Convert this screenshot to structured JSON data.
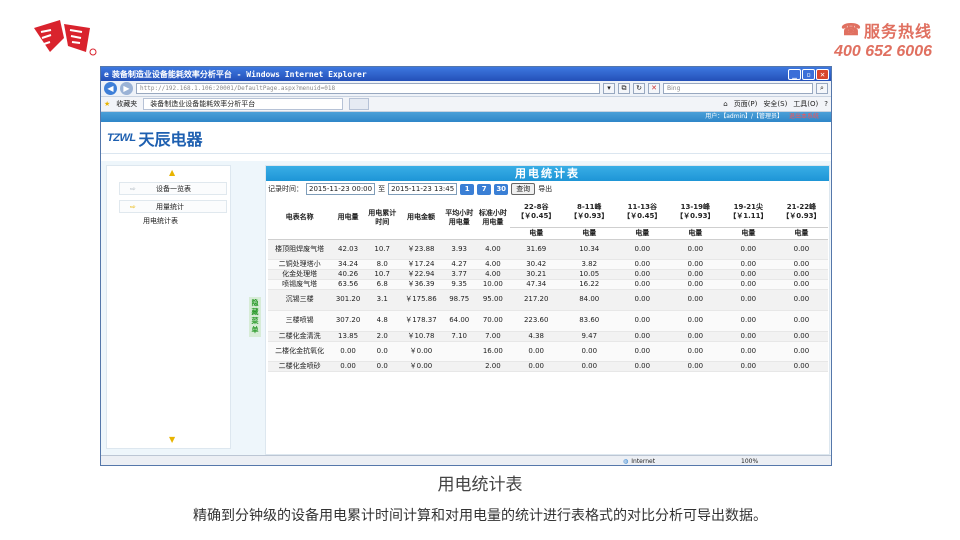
{
  "slide": {
    "hotline_label": "服务热线",
    "hotline_number": "400 652 6006",
    "caption": "用电统计表",
    "description": "精确到分钟级的设备用电累计时间计算和对用电量的统计进行表格式的对比分析可导出数据。"
  },
  "ie": {
    "title": "装备制造业设备能耗效率分析平台 - Windows Internet Explorer",
    "address": "http://192.168.1.106:20001/DefaultPage.aspx?menuid=018",
    "search_placeholder": "Bing",
    "favorites": "收藏夹",
    "tab_label": "装备制造业设备能耗效率分析平台",
    "page_menu": "页面(P)",
    "safety_menu": "安全(S)",
    "tools_menu": "工具(O)",
    "status_zone": "Internet",
    "zoom": "100%"
  },
  "app": {
    "user_text": "用户：【admin】/【管理员】",
    "exit_text": "退出本系统",
    "brand_mark": "TZWL",
    "brand_name": "天辰电器",
    "sidebar": {
      "items": [
        {
          "label": "设备一览表"
        },
        {
          "label": "用量统计"
        }
      ],
      "sub_item": "用电统计表",
      "hide_menu": "隐藏菜单"
    },
    "panel_title": "用电统计表",
    "toolbar": {
      "time_label": "记录时间：",
      "start": "2015-11-23 00:00",
      "to": "至",
      "end": "2015-11-23 13:45",
      "btn1": "1",
      "btn7": "7",
      "btn30": "30",
      "query": "查询",
      "export": "导出"
    }
  },
  "table": {
    "headers": {
      "name": "电表名称",
      "usage": "用电量",
      "time": "用电累计时间",
      "amount": "用电金额",
      "avg": "平均小时用电量",
      "std": "标准小时用电量",
      "p1": "22-8谷【￥0.45】",
      "p2": "8-11峰【￥0.93】",
      "p3": "11-13谷【￥0.45】",
      "p4": "13-19峰【￥0.93】",
      "p5": "19-21尖【￥1.11】",
      "p6": "21-22峰【￥0.93】",
      "sub": "电量"
    },
    "rows": [
      {
        "name": "楼顶阻焊废气塔",
        "usage": "42.03",
        "time": "10.7",
        "amount": "￥23.88",
        "avg": "3.93",
        "std": "4.00",
        "p1": "31.69",
        "p2": "10.34",
        "p3": "0.00",
        "p4": "0.00",
        "p5": "0.00",
        "p6": "0.00"
      },
      {
        "name": "二铜处理塔小",
        "usage": "34.24",
        "time": "8.0",
        "amount": "￥17.24",
        "avg": "4.27",
        "std": "4.00",
        "p1": "30.42",
        "p2": "3.82",
        "p3": "0.00",
        "p4": "0.00",
        "p5": "0.00",
        "p6": "0.00"
      },
      {
        "name": "化金处理塔",
        "usage": "40.26",
        "time": "10.7",
        "amount": "￥22.94",
        "avg": "3.77",
        "std": "4.00",
        "p1": "30.21",
        "p2": "10.05",
        "p3": "0.00",
        "p4": "0.00",
        "p5": "0.00",
        "p6": "0.00"
      },
      {
        "name": "喷锡废气塔",
        "usage": "63.56",
        "time": "6.8",
        "amount": "￥36.39",
        "avg": "9.35",
        "std": "10.00",
        "p1": "47.34",
        "p2": "16.22",
        "p3": "0.00",
        "p4": "0.00",
        "p5": "0.00",
        "p6": "0.00"
      },
      {
        "name": "沉锡三楼",
        "usage": "301.20",
        "time": "3.1",
        "amount": "￥175.86",
        "avg": "98.75",
        "std": "95.00",
        "p1": "217.20",
        "p2": "84.00",
        "p3": "0.00",
        "p4": "0.00",
        "p5": "0.00",
        "p6": "0.00"
      },
      {
        "name": "三楼喷锡",
        "usage": "307.20",
        "time": "4.8",
        "amount": "￥178.37",
        "avg": "64.00",
        "std": "70.00",
        "p1": "223.60",
        "p2": "83.60",
        "p3": "0.00",
        "p4": "0.00",
        "p5": "0.00",
        "p6": "0.00"
      },
      {
        "name": "二楼化金清洗",
        "usage": "13.85",
        "time": "2.0",
        "amount": "￥10.78",
        "avg": "7.10",
        "std": "7.00",
        "p1": "4.38",
        "p2": "9.47",
        "p3": "0.00",
        "p4": "0.00",
        "p5": "0.00",
        "p6": "0.00"
      },
      {
        "name": "二楼化金抗氧化",
        "usage": "0.00",
        "time": "0.0",
        "amount": "￥0.00",
        "avg": "",
        "std": "16.00",
        "p1": "0.00",
        "p2": "0.00",
        "p3": "0.00",
        "p4": "0.00",
        "p5": "0.00",
        "p6": "0.00"
      },
      {
        "name": "二楼化金喷砂",
        "usage": "0.00",
        "time": "0.0",
        "amount": "￥0.00",
        "avg": "",
        "std": "2.00",
        "p1": "0.00",
        "p2": "0.00",
        "p3": "0.00",
        "p4": "0.00",
        "p5": "0.00",
        "p6": "0.00"
      }
    ]
  },
  "colors": {
    "accent": "#1e95d6",
    "brand": "#1d5fb0",
    "logo_red": "#d9232d",
    "hotline": "#e07060"
  }
}
